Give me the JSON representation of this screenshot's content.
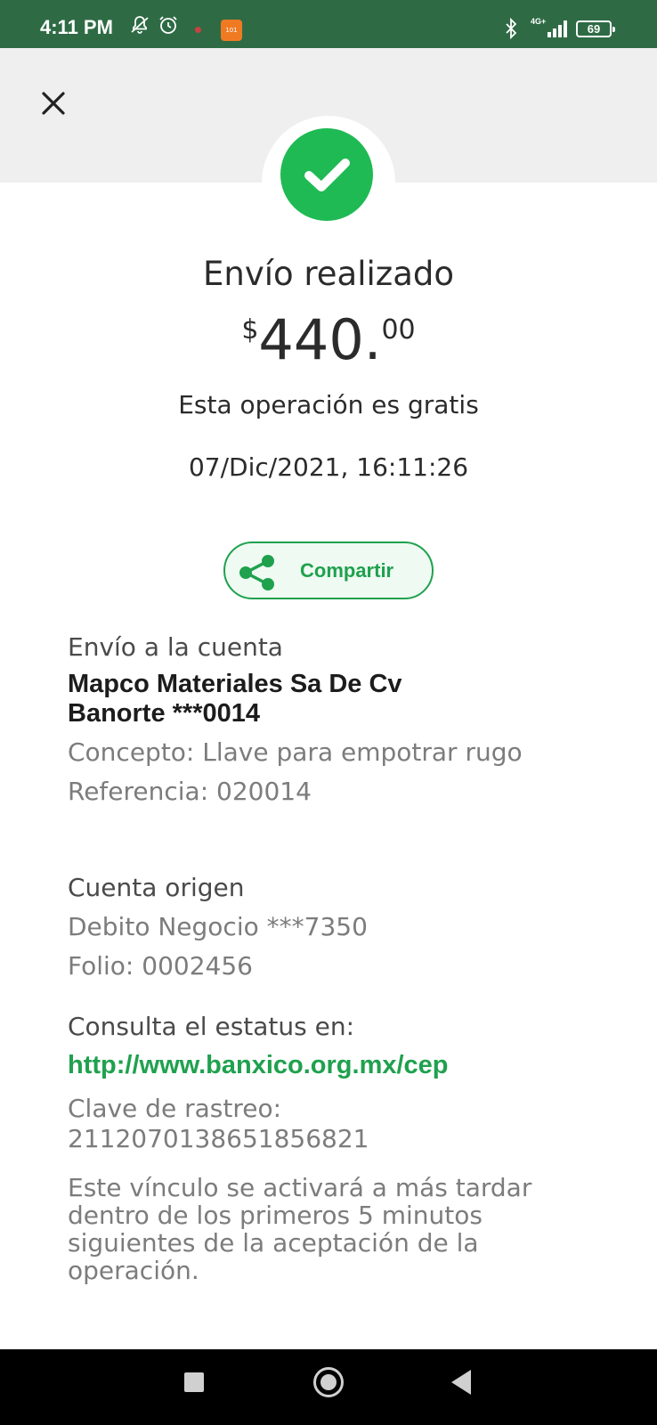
{
  "status_bar": {
    "time": "4:11 PM",
    "badge_text": "101",
    "network": "4G+",
    "battery": "69",
    "icons": [
      "silent-icon",
      "alarm-icon",
      "notification-dot-icon",
      "app-badge-icon",
      "bluetooth-icon",
      "signal-icon",
      "battery-icon"
    ]
  },
  "header": {
    "close_icon": "close-icon",
    "status_icon": "check-icon"
  },
  "summary": {
    "title": "Envío realizado",
    "currency": "$",
    "amount_int": "440.",
    "amount_dec": "00",
    "fee_note": "Esta operación es gratis",
    "datetime": "07/Dic/2021, 16:11:26"
  },
  "share": {
    "label": "Compartir",
    "icon": "share-icon"
  },
  "destination": {
    "heading": "Envío a la cuenta",
    "name": "Mapco Materiales Sa De  Cv",
    "bank_account": "Banorte ***0014",
    "concept": "Concepto: Llave para empotrar rugo",
    "reference": "Referencia: 020014"
  },
  "origin": {
    "heading": "Cuenta origen",
    "account": "Debito Negocio  ***7350",
    "folio": "Folio: 0002456"
  },
  "status_info": {
    "heading": "Consulta el estatus en:",
    "link": "http://www.banxico.org.mx/cep",
    "tracking_label": "Clave de rastreo:",
    "tracking_value": "2112070138651856821",
    "note": "Este vínculo se activará a más tardar dentro de los primeros 5 minutos siguientes de la aceptación de la operación."
  },
  "colors": {
    "status_bar": "#2e6b45",
    "accent_green": "#1fa14e",
    "check_green": "#1fba54",
    "header_gray": "#efefef"
  }
}
